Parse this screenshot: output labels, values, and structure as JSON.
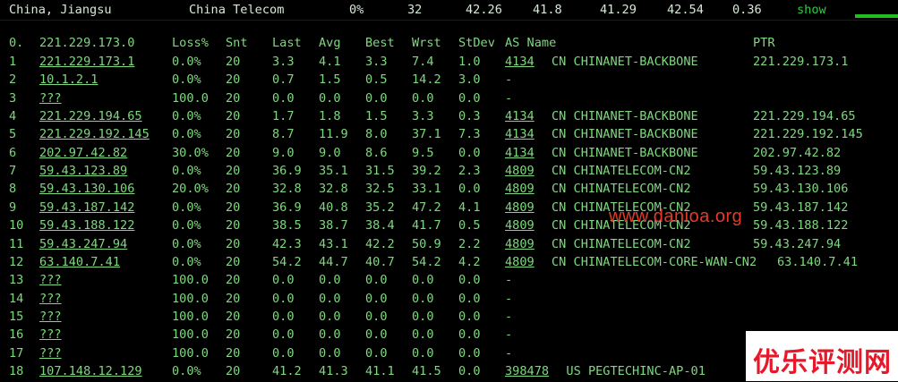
{
  "summary": {
    "location": "China, Jiangsu",
    "isp": "China Telecom",
    "loss": "0%",
    "sent": "32",
    "last": "42.26",
    "avg": "41.8",
    "best": "41.29",
    "worst": "42.54",
    "stdev": "0.36",
    "show_label": "show"
  },
  "columns": {
    "idx": "0.",
    "host": "221.229.173.0",
    "loss": "Loss%",
    "snt": "Snt",
    "last": "Last",
    "avg": "Avg",
    "best": "Best",
    "wrst": "Wrst",
    "stdev": "StDev",
    "as": "AS Name",
    "ptr": "PTR"
  },
  "hops": [
    {
      "idx": "1",
      "host": "221.229.173.1",
      "loss": "0.0%",
      "snt": "20",
      "last": "3.3",
      "avg": "4.1",
      "best": "3.3",
      "wrst": "7.4",
      "stdev": "1.0",
      "asn": "4134",
      "as_name": "CN CHINANET-BACKBONE",
      "ptr": "221.229.173.1"
    },
    {
      "idx": "2",
      "host": "10.1.2.1",
      "loss": "0.0%",
      "snt": "20",
      "last": "0.7",
      "avg": "1.5",
      "best": "0.5",
      "wrst": "14.2",
      "stdev": "3.0",
      "asn": "",
      "as_name": "-",
      "ptr": ""
    },
    {
      "idx": "3",
      "host": "???",
      "loss": "100.0",
      "snt": "20",
      "last": "0.0",
      "avg": "0.0",
      "best": "0.0",
      "wrst": "0.0",
      "stdev": "0.0",
      "asn": "",
      "as_name": "-",
      "ptr": ""
    },
    {
      "idx": "4",
      "host": "221.229.194.65",
      "loss": "0.0%",
      "snt": "20",
      "last": "1.7",
      "avg": "1.8",
      "best": "1.5",
      "wrst": "3.3",
      "stdev": "0.3",
      "asn": "4134",
      "as_name": "CN CHINANET-BACKBONE",
      "ptr": "221.229.194.65"
    },
    {
      "idx": "5",
      "host": "221.229.192.145",
      "loss": "0.0%",
      "snt": "20",
      "last": "8.7",
      "avg": "11.9",
      "best": "8.0",
      "wrst": "37.1",
      "stdev": "7.3",
      "asn": "4134",
      "as_name": "CN CHINANET-BACKBONE",
      "ptr": "221.229.192.145"
    },
    {
      "idx": "6",
      "host": "202.97.42.82",
      "loss": "30.0%",
      "snt": "20",
      "last": "9.0",
      "avg": "9.0",
      "best": "8.6",
      "wrst": "9.5",
      "stdev": "0.0",
      "asn": "4134",
      "as_name": "CN CHINANET-BACKBONE",
      "ptr": "202.97.42.82"
    },
    {
      "idx": "7",
      "host": "59.43.123.89",
      "loss": "0.0%",
      "snt": "20",
      "last": "36.9",
      "avg": "35.1",
      "best": "31.5",
      "wrst": "39.2",
      "stdev": "2.3",
      "asn": "4809",
      "as_name": "CN CHINATELECOM-CN2",
      "ptr": "59.43.123.89"
    },
    {
      "idx": "8",
      "host": "59.43.130.106",
      "loss": "20.0%",
      "snt": "20",
      "last": "32.8",
      "avg": "32.8",
      "best": "32.5",
      "wrst": "33.1",
      "stdev": "0.0",
      "asn": "4809",
      "as_name": "CN CHINATELECOM-CN2",
      "ptr": "59.43.130.106"
    },
    {
      "idx": "9",
      "host": "59.43.187.142",
      "loss": "0.0%",
      "snt": "20",
      "last": "36.9",
      "avg": "40.8",
      "best": "35.2",
      "wrst": "47.2",
      "stdev": "4.1",
      "asn": "4809",
      "as_name": "CN CHINATELECOM-CN2",
      "ptr": "59.43.187.142"
    },
    {
      "idx": "10",
      "host": "59.43.188.122",
      "loss": "0.0%",
      "snt": "20",
      "last": "38.5",
      "avg": "38.7",
      "best": "38.4",
      "wrst": "41.7",
      "stdev": "0.5",
      "asn": "4809",
      "as_name": "CN CHINATELECOM-CN2",
      "ptr": "59.43.188.122"
    },
    {
      "idx": "11",
      "host": "59.43.247.94",
      "loss": "0.0%",
      "snt": "20",
      "last": "42.3",
      "avg": "43.1",
      "best": "42.2",
      "wrst": "50.9",
      "stdev": "2.2",
      "asn": "4809",
      "as_name": "CN CHINATELECOM-CN2",
      "ptr": "59.43.247.94"
    },
    {
      "idx": "12",
      "host": "63.140.7.41",
      "loss": "0.0%",
      "snt": "20",
      "last": "54.2",
      "avg": "44.7",
      "best": "40.7",
      "wrst": "54.2",
      "stdev": "4.2",
      "asn": "4809",
      "as_name": "CN CHINATELECOM-CORE-WAN-CN2",
      "ptr": "63.140.7.41"
    },
    {
      "idx": "13",
      "host": "???",
      "loss": "100.0",
      "snt": "20",
      "last": "0.0",
      "avg": "0.0",
      "best": "0.0",
      "wrst": "0.0",
      "stdev": "0.0",
      "asn": "",
      "as_name": "-",
      "ptr": ""
    },
    {
      "idx": "14",
      "host": "???",
      "loss": "100.0",
      "snt": "20",
      "last": "0.0",
      "avg": "0.0",
      "best": "0.0",
      "wrst": "0.0",
      "stdev": "0.0",
      "asn": "",
      "as_name": "-",
      "ptr": ""
    },
    {
      "idx": "15",
      "host": "???",
      "loss": "100.0",
      "snt": "20",
      "last": "0.0",
      "avg": "0.0",
      "best": "0.0",
      "wrst": "0.0",
      "stdev": "0.0",
      "asn": "",
      "as_name": "-",
      "ptr": ""
    },
    {
      "idx": "16",
      "host": "???",
      "loss": "100.0",
      "snt": "20",
      "last": "0.0",
      "avg": "0.0",
      "best": "0.0",
      "wrst": "0.0",
      "stdev": "0.0",
      "asn": "",
      "as_name": "-",
      "ptr": ""
    },
    {
      "idx": "17",
      "host": "???",
      "loss": "100.0",
      "snt": "20",
      "last": "0.0",
      "avg": "0.0",
      "best": "0.0",
      "wrst": "0.0",
      "stdev": "0.0",
      "asn": "",
      "as_name": "-",
      "ptr": ""
    },
    {
      "idx": "18",
      "host": "107.148.12.129",
      "loss": "0.0%",
      "snt": "20",
      "last": "41.2",
      "avg": "41.3",
      "best": "41.1",
      "wrst": "41.5",
      "stdev": "0.0",
      "asn": "398478",
      "as_name": "US PEGTECHINC-AP-01",
      "ptr": ""
    }
  ],
  "watermark": "www.danioa.org",
  "brand_logo_text": "优乐评测网",
  "colors": {
    "text": "#7fd87f",
    "show": "#2ecc40",
    "bar": "#1fbf1f",
    "watermark": "#e23b2b",
    "brand": "#e6192a"
  }
}
